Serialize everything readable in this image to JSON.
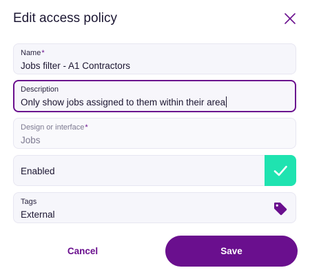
{
  "dialog": {
    "title": "Edit access policy",
    "close_icon": "close-icon"
  },
  "fields": {
    "name": {
      "label": "Name",
      "required_mark": "*",
      "value": "Jobs filter - A1 Contractors"
    },
    "description": {
      "label": "Description",
      "value": "Only show jobs assigned to them within their area"
    },
    "design": {
      "label": "Design or interface",
      "required_mark": "*",
      "value": "Jobs"
    },
    "enabled": {
      "label": "Enabled",
      "checked": true,
      "icon": "check-icon"
    },
    "tags": {
      "label": "Tags",
      "value": "External",
      "icon": "tag-icon"
    }
  },
  "actions": {
    "cancel_label": "Cancel",
    "save_label": "Save"
  },
  "colors": {
    "accent": "#6a0f8e",
    "toggle_on": "#1fe3b0",
    "field_bg": "#f6f6fb",
    "text": "#1b1530"
  }
}
